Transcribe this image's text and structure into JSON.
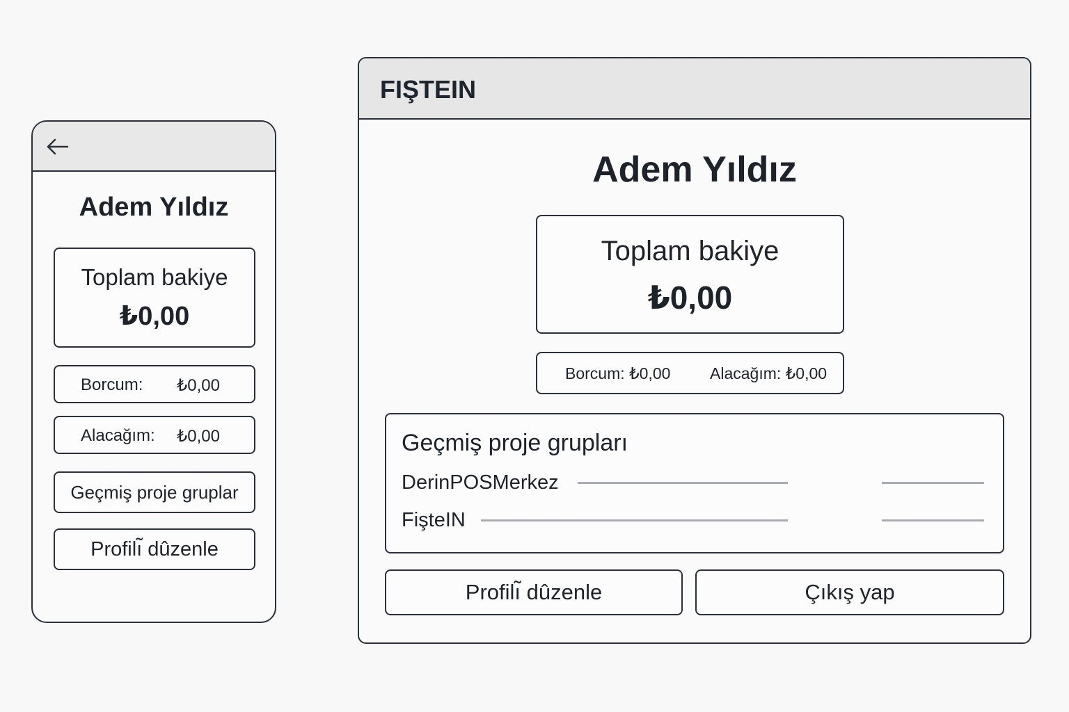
{
  "mobile": {
    "back_icon": "arrow-left-icon",
    "user_name": "Adem Yıldız",
    "balance": {
      "label": "Toplam bakiye",
      "amount": "₺0,00"
    },
    "debt": {
      "label": "Borcum:",
      "amount": "₺0,00"
    },
    "receivable": {
      "label": "Alacağım:",
      "amount": "₺0,00"
    },
    "history_button": "Geçmiş proje gruplar",
    "edit_profile_button": "Profilı̃ dûzenle"
  },
  "desktop": {
    "app_title": "FIŞTEIN",
    "user_name": "Adem Yıldız",
    "balance": {
      "label": "Toplam bakiye",
      "amount": "₺0,00"
    },
    "summary": {
      "debt": "Borcum: ₺0,00",
      "receivable": "Alacağım: ₺0,00"
    },
    "groups": {
      "title": "Geçmiş proje grupları",
      "items": [
        "DerinPOSMerkez",
        "FişteIN"
      ]
    },
    "edit_profile_button": "Profilı̃ dûzenle",
    "logout_button": "Çıkış yap"
  }
}
